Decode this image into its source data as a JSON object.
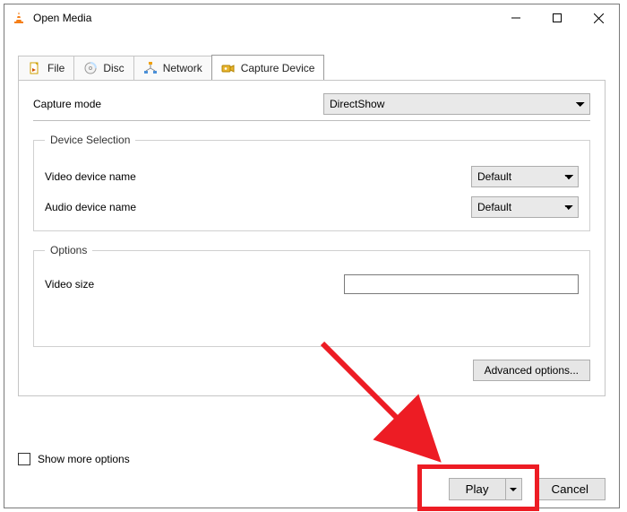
{
  "window": {
    "title": "Open Media"
  },
  "tabs": {
    "file": "File",
    "disc": "Disc",
    "network": "Network",
    "capture": "Capture Device"
  },
  "capture": {
    "mode_label": "Capture mode",
    "mode_value": "DirectShow"
  },
  "device_selection": {
    "legend": "Device Selection",
    "video_label": "Video device name",
    "video_value": "Default",
    "audio_label": "Audio device name",
    "audio_value": "Default"
  },
  "options_group": {
    "legend": "Options",
    "video_size_label": "Video size",
    "video_size_value": ""
  },
  "buttons": {
    "advanced": "Advanced options...",
    "play": "Play",
    "cancel": "Cancel"
  },
  "show_more": {
    "label": "Show more options",
    "checked": false
  }
}
